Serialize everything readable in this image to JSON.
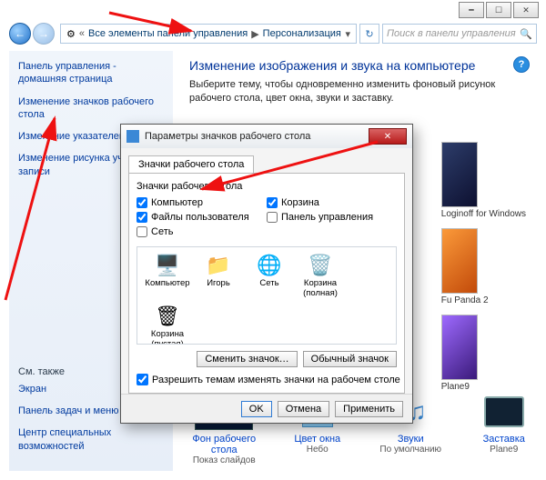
{
  "breadcrumb": {
    "level1": "Все элементы панели управления",
    "level2": "Персонализация"
  },
  "search": {
    "placeholder": "Поиск в панели управления"
  },
  "sidebar": {
    "links": [
      "Панель управления - домашняя страница",
      "Изменение значков рабочего стола",
      "Изменение указателей мыши",
      "Изменение рисунка учетной записи"
    ],
    "see_also_hdr": "См. также",
    "see_also": [
      "Экран",
      "Панель задач и меню \"Пуск\"",
      "Центр специальных возможностей"
    ]
  },
  "main": {
    "title": "Изменение изображения и звука на компьютере",
    "desc": "Выберите тему, чтобы одновременно изменить фоновый рисунок рабочего стола, цвет окна, звуки и заставку.",
    "visible_theme_labels": [
      "Loginoff for Windows",
      "Fu Panda 2",
      "Plane9"
    ]
  },
  "bottom": {
    "items": [
      {
        "label": "Фон рабочего стола",
        "sub": "Показ слайдов"
      },
      {
        "label": "Цвет окна",
        "sub": "Небо"
      },
      {
        "label": "Звуки",
        "sub": "По умолчанию"
      },
      {
        "label": "Заставка",
        "sub": "Plane9"
      }
    ]
  },
  "dialog": {
    "title": "Параметры значков рабочего стола",
    "tab": "Значки рабочего стола",
    "group": "Значки рабочего стола",
    "checks": {
      "computer": "Компьютер",
      "recycle": "Корзина",
      "userfiles": "Файлы пользователя",
      "cpl": "Панель управления",
      "network": "Сеть"
    },
    "icons": [
      "Компьютер",
      "Игорь",
      "Сеть",
      "Корзина (полная)",
      "Корзина (пустая)"
    ],
    "change_btn": "Сменить значок…",
    "default_btn": "Обычный значок",
    "allow": "Разрешить темам изменять значки на рабочем столе",
    "ok": "OK",
    "cancel": "Отмена",
    "apply": "Применить"
  }
}
